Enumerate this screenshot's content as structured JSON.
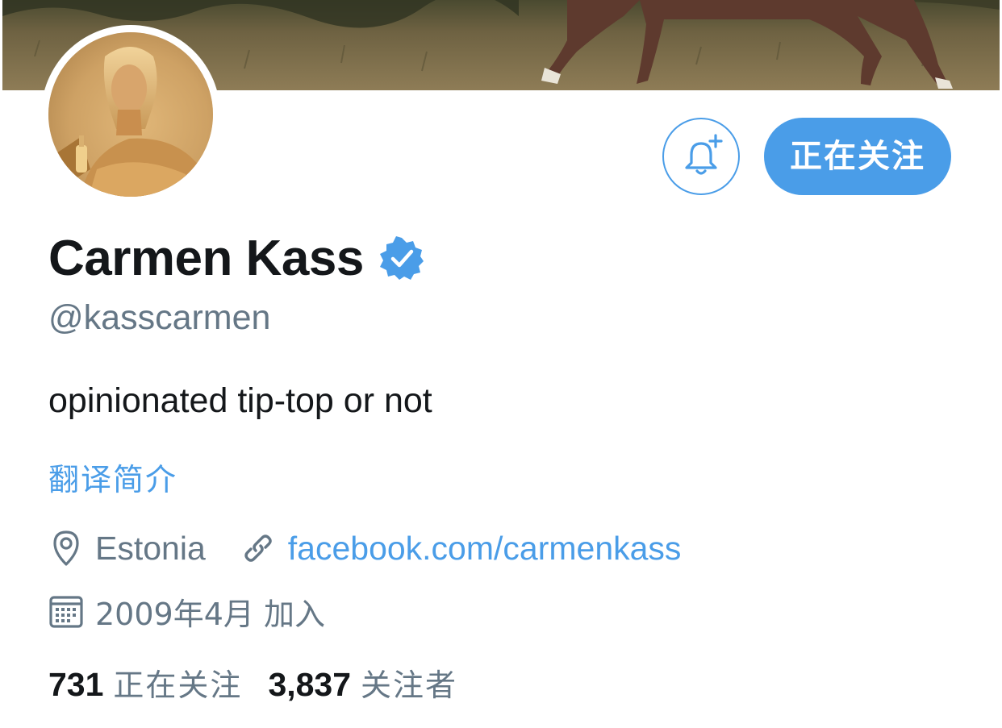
{
  "profile": {
    "display_name": "Carmen Kass",
    "verified": true,
    "handle": "@kasscarmen",
    "bio": "opinionated tip-top or not",
    "translate_label": "翻译简介",
    "location": "Estonia",
    "website": "facebook.com/carmenkass",
    "joined": "2009年4月 加入"
  },
  "actions": {
    "notify_icon": "bell-plus-icon",
    "following_label": "正在关注"
  },
  "stats": {
    "following_count": "731",
    "following_label": "正在关注",
    "followers_count": "3,837",
    "followers_label": "关注者"
  },
  "colors": {
    "accent": "#4a9de8",
    "text_primary": "#14171a",
    "text_secondary": "#657786"
  },
  "icons": {
    "location": "location-pin-icon",
    "link": "link-icon",
    "calendar": "calendar-icon",
    "verified": "verified-badge-icon"
  }
}
